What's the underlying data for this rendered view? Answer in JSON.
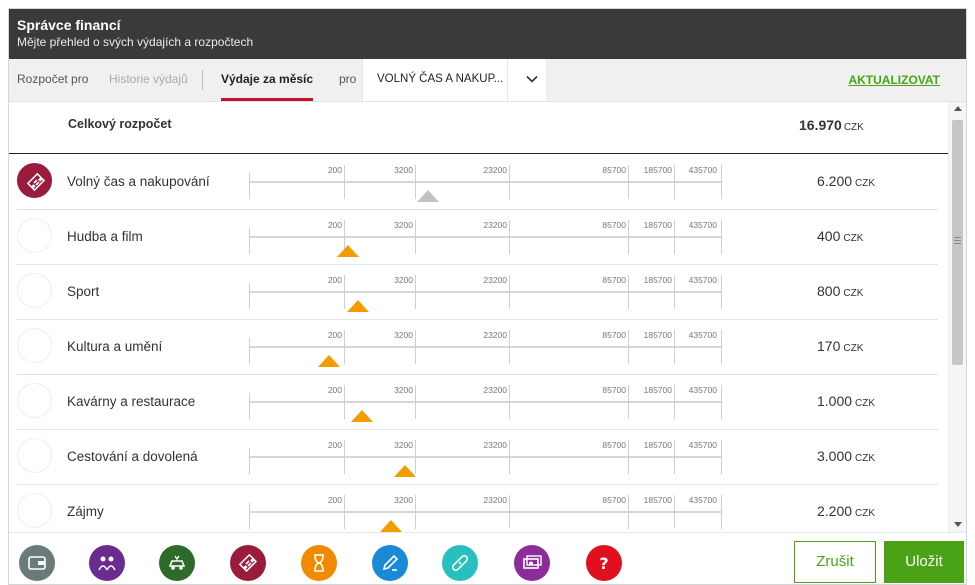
{
  "header": {
    "title": "Správce financí",
    "subtitle": "Mějte přehled o svých výdajích a rozpočtech"
  },
  "toolbar": {
    "tab_budget": "Rozpočet pro",
    "tab_history": "Historie výdajů",
    "tab_month": "Výdaje za měsíc",
    "pro_label": "pro",
    "category_select": "VOLNÝ ČAS A NAKUP...",
    "refresh": "AKTUALIZOVAT"
  },
  "total": {
    "label": "Celkový rozpočet",
    "amount": "16.970",
    "currency": "CZK"
  },
  "scale_labels": [
    "200",
    "3200",
    "23200",
    "85700",
    "185700",
    "435700"
  ],
  "rows": [
    {
      "name": "Volný čas a nakupování",
      "value": "6.200",
      "currency": "CZK",
      "marker": 0.38,
      "marker_color": "grey",
      "icon": "ticket-icon",
      "active": true
    },
    {
      "name": "Hudba a film",
      "value": "400",
      "currency": "CZK",
      "marker": 0.21,
      "marker_color": "orange",
      "icon": "",
      "active": false
    },
    {
      "name": "Sport",
      "value": "800",
      "currency": "CZK",
      "marker": 0.23,
      "marker_color": "orange",
      "icon": "",
      "active": false
    },
    {
      "name": "Kultura a umění",
      "value": "170",
      "currency": "CZK",
      "marker": 0.17,
      "marker_color": "orange",
      "icon": "",
      "active": false
    },
    {
      "name": "Kavárny a restaurace",
      "value": "1.000",
      "currency": "CZK",
      "marker": 0.24,
      "marker_color": "orange",
      "icon": "",
      "active": false
    },
    {
      "name": "Cestování a dovolená",
      "value": "3.000",
      "currency": "CZK",
      "marker": 0.33,
      "marker_color": "orange",
      "icon": "",
      "active": false
    },
    {
      "name": "Zájmy",
      "value": "2.200",
      "currency": "CZK",
      "marker": 0.3,
      "marker_color": "orange",
      "icon": "",
      "active": false
    }
  ],
  "bottom_icons": [
    {
      "name": "wallet-icon",
      "color": "#6b7b7b"
    },
    {
      "name": "family-icon",
      "color": "#6a2c8f"
    },
    {
      "name": "car-icon",
      "color": "#2e6b2a"
    },
    {
      "name": "ticket-icon",
      "color": "#9b1b3c"
    },
    {
      "name": "hourglass-icon",
      "color": "#f08a00"
    },
    {
      "name": "pen-icon",
      "color": "#1a8ad6"
    },
    {
      "name": "bandage-icon",
      "color": "#28c0bf"
    },
    {
      "name": "money-icon",
      "color": "#8e2b9b"
    },
    {
      "name": "question-icon",
      "color": "#e20f1f"
    }
  ],
  "buttons": {
    "cancel": "Zrušit",
    "save": "Uložit"
  },
  "colors": {
    "accent": "#c8102e",
    "green": "#4aa317",
    "marker": "#f39c00",
    "header_bg": "#3a3a3a"
  }
}
